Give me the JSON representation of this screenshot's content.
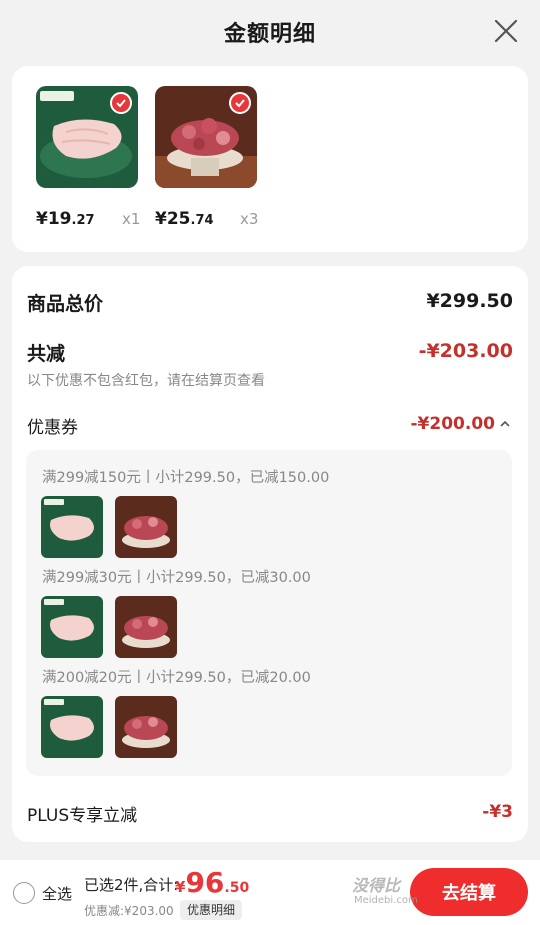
{
  "header": {
    "title": "金额明细"
  },
  "products": [
    {
      "name": "chicken-wings",
      "price_int": "¥19",
      "price_dec": ".27",
      "qty": "x1",
      "brand_tag": "东方甄选"
    },
    {
      "name": "beef-tendon",
      "price_int": "¥25",
      "price_dec": ".74",
      "qty": "x3"
    }
  ],
  "detail": {
    "total_label": "商品总价",
    "total_value": "¥299.50",
    "reduce_label": "共减",
    "reduce_value": "-¥203.00",
    "reduce_note": "以下优惠不包含红包，请在结算页查看",
    "coupon_label": "优惠券",
    "coupon_value": "-¥200.00",
    "coupons": [
      {
        "text": "满299减150元丨小计299.50，已减150.00"
      },
      {
        "text": "满299减30元丨小计299.50，已减30.00"
      },
      {
        "text": "满200减20元丨小计299.50，已减20.00"
      }
    ],
    "plus_label": "PLUS专享立减",
    "plus_value": "-¥3"
  },
  "bottom": {
    "select_all": "全选",
    "summary": "已选2件,合计:",
    "total_currency": "¥",
    "total_int": "96",
    "total_dec": ".50",
    "discount": "优惠减:¥203.00",
    "detail_link": "优惠明细",
    "checkout": "去结算"
  },
  "watermark": {
    "text": "没得比",
    "sub": "Meidebi.com"
  },
  "colors": {
    "accent": "#e8373a",
    "discount_red": "#c5302c",
    "background": "#f2f2f2"
  }
}
